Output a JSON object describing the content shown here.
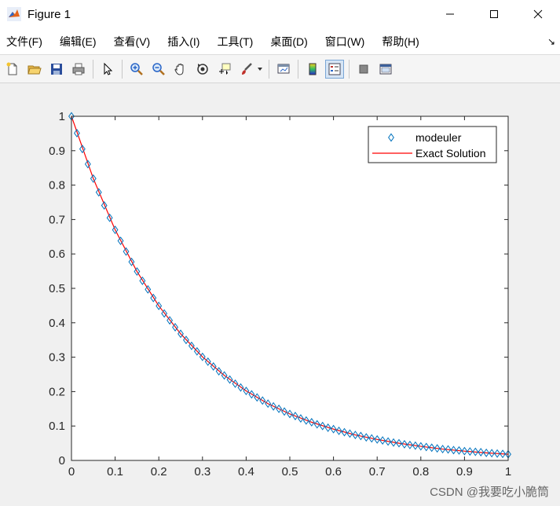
{
  "window": {
    "title": "Figure 1",
    "controls": {
      "minimize": "—",
      "maximize": "☐",
      "close": "✕"
    }
  },
  "menubar": {
    "items": [
      {
        "label": "文件(F)"
      },
      {
        "label": "编辑(E)"
      },
      {
        "label": "查看(V)"
      },
      {
        "label": "插入(I)"
      },
      {
        "label": "工具(T)"
      },
      {
        "label": "桌面(D)"
      },
      {
        "label": "窗口(W)"
      },
      {
        "label": "帮助(H)"
      }
    ],
    "overflow_icon": "arrow-icon"
  },
  "toolbar": {
    "buttons": [
      "new-figure-icon",
      "open-file-icon",
      "save-icon",
      "print-icon",
      "pointer-icon",
      "zoom-in-icon",
      "zoom-out-icon",
      "pan-icon",
      "rotate-3d-icon",
      "data-cursor-icon",
      "brush-icon",
      "link-plot-icon",
      "colorbar-icon",
      "legend-icon",
      "hide-plot-tools-icon",
      "show-plot-tools-icon"
    ]
  },
  "watermark": "CSDN @我要吃小脆筒",
  "colors": {
    "marker": "#0072BD",
    "line": "#FF0000"
  },
  "chart_data": {
    "type": "line",
    "xlim": [
      0,
      1
    ],
    "ylim": [
      0,
      1
    ],
    "xticks": [
      "0",
      "0.1",
      "0.2",
      "0.3",
      "0.4",
      "0.5",
      "0.6",
      "0.7",
      "0.8",
      "0.9",
      "1"
    ],
    "yticks": [
      "0",
      "0.1",
      "0.2",
      "0.3",
      "0.4",
      "0.5",
      "0.6",
      "0.7",
      "0.8",
      "0.9",
      "1"
    ],
    "legend_position": "top-right",
    "series": [
      {
        "name": "modeuler",
        "style": "diamond-markers",
        "x": [
          0,
          0.0125,
          0.025,
          0.0375,
          0.05,
          0.0625,
          0.075,
          0.0875,
          0.1,
          0.1125,
          0.125,
          0.1375,
          0.15,
          0.1625,
          0.175,
          0.1875,
          0.2,
          0.2125,
          0.225,
          0.2375,
          0.25,
          0.2625,
          0.275,
          0.2875,
          0.3,
          0.3125,
          0.325,
          0.3375,
          0.35,
          0.3625,
          0.375,
          0.3875,
          0.4,
          0.4125,
          0.425,
          0.4375,
          0.45,
          0.4625,
          0.475,
          0.4875,
          0.5,
          0.5125,
          0.525,
          0.5375,
          0.55,
          0.5625,
          0.575,
          0.5875,
          0.6,
          0.6125,
          0.625,
          0.6375,
          0.65,
          0.6625,
          0.675,
          0.6875,
          0.7,
          0.7125,
          0.725,
          0.7375,
          0.75,
          0.7625,
          0.775,
          0.7875,
          0.8,
          0.8125,
          0.825,
          0.8375,
          0.85,
          0.8625,
          0.875,
          0.8875,
          0.9,
          0.9125,
          0.925,
          0.9375,
          0.95,
          0.9625,
          0.975,
          0.9875,
          1
        ],
        "y": [
          1,
          0.951,
          0.905,
          0.861,
          0.819,
          0.779,
          0.741,
          0.705,
          0.67,
          0.638,
          0.607,
          0.577,
          0.549,
          0.522,
          0.497,
          0.472,
          0.449,
          0.427,
          0.407,
          0.387,
          0.368,
          0.35,
          0.333,
          0.317,
          0.301,
          0.287,
          0.273,
          0.259,
          0.247,
          0.235,
          0.223,
          0.212,
          0.202,
          0.192,
          0.183,
          0.174,
          0.165,
          0.157,
          0.15,
          0.142,
          0.135,
          0.129,
          0.122,
          0.116,
          0.111,
          0.105,
          0.1,
          0.095,
          0.091,
          0.086,
          0.082,
          0.078,
          0.074,
          0.071,
          0.067,
          0.064,
          0.061,
          0.058,
          0.055,
          0.052,
          0.05,
          0.047,
          0.045,
          0.043,
          0.041,
          0.039,
          0.037,
          0.035,
          0.033,
          0.032,
          0.03,
          0.029,
          0.027,
          0.026,
          0.025,
          0.024,
          0.022,
          0.021,
          0.02,
          0.019,
          0.018
        ]
      },
      {
        "name": "Exact Solution",
        "style": "solid-line",
        "x": [
          0,
          0.05,
          0.1,
          0.15,
          0.2,
          0.25,
          0.3,
          0.35,
          0.4,
          0.45,
          0.5,
          0.55,
          0.6,
          0.65,
          0.7,
          0.75,
          0.8,
          0.85,
          0.9,
          0.95,
          1
        ],
        "y": [
          1,
          0.819,
          0.67,
          0.549,
          0.449,
          0.368,
          0.301,
          0.247,
          0.202,
          0.165,
          0.135,
          0.111,
          0.091,
          0.074,
          0.061,
          0.05,
          0.041,
          0.033,
          0.027,
          0.022,
          0.018
        ]
      }
    ]
  }
}
